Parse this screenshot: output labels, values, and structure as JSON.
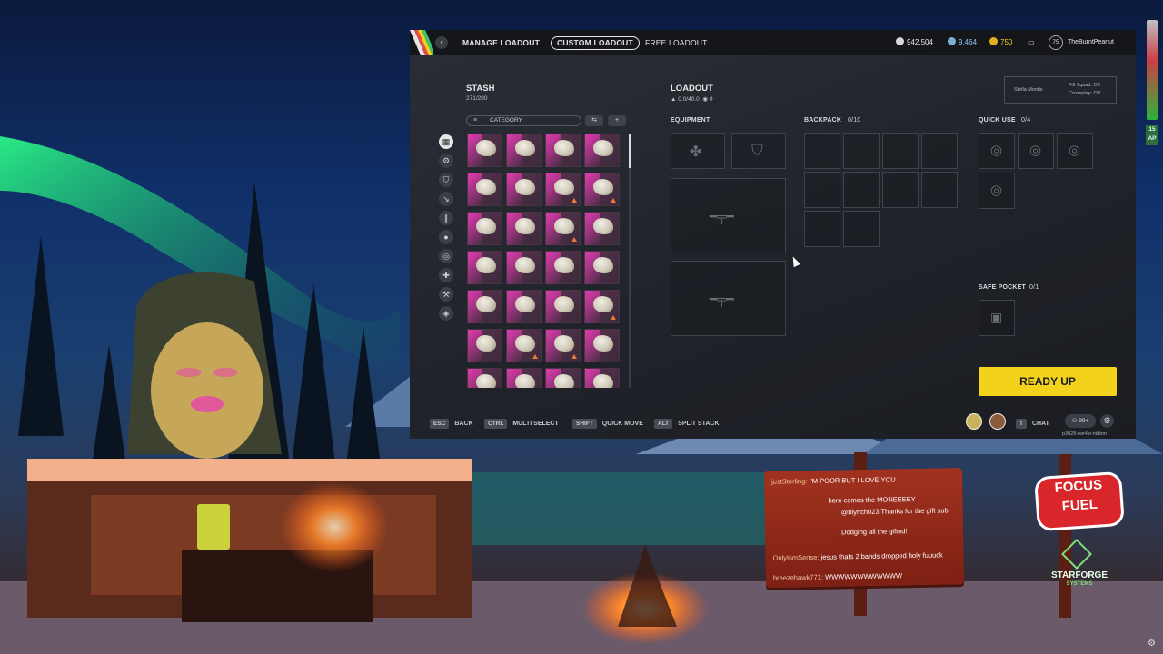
{
  "topbar": {
    "tabs": [
      {
        "label": "MANAGE LOADOUT",
        "active": false
      },
      {
        "label": "CUSTOM LOADOUT",
        "active": true
      },
      {
        "label": "FREE LOADOUT",
        "active": false
      }
    ],
    "currency1": "942,504",
    "currency2": "9,464",
    "currency3": "750",
    "level": "75",
    "username": "TheBurntPeanut"
  },
  "stash": {
    "title": "STASH",
    "count": "271/280",
    "category_label": "CATEGORY",
    "category_icons": [
      "grid-icon",
      "attachment-icon",
      "shield-icon",
      "knife-icon",
      "ammo-icon",
      "grenade-icon",
      "ring-icon",
      "medkit-icon",
      "wrench-icon",
      "cube-icon"
    ]
  },
  "loadout": {
    "title": "LOADOUT",
    "weight": "0.0/40.0",
    "value": "0",
    "server": "Stella Montis",
    "fill_squad": "Fill Squad: Off",
    "crossplay": "Crossplay: Off",
    "equipment_label": "EQUIPMENT",
    "backpack_label": "BACKPACK",
    "backpack_count": "0/10",
    "quick_use_label": "QUICK USE",
    "quick_use_count": "0/4",
    "safe_pocket_label": "SAFE POCKET",
    "safe_pocket_count": "0/1",
    "ready_label": "READY UP"
  },
  "hints": [
    {
      "key": "ESC",
      "label": "BACK"
    },
    {
      "key": "CTRL",
      "label": "MULTI SELECT"
    },
    {
      "key": "SHIFT",
      "label": "QUICK MOVE"
    },
    {
      "key": "ALT",
      "label": "SPLIT STACK"
    }
  ],
  "footer": {
    "chat_key": "T",
    "chat_label": "CHAT",
    "party_count": "99+",
    "session_code": "p3028-rwr4w-ntdbm"
  },
  "side_hud": {
    "ap": "15",
    "ap_label": "AP"
  },
  "stream_chat": [
    {
      "name": "justSterling:",
      "msg": "I'M POOR BUT I LOVE YOU"
    },
    {
      "name": "",
      "msg": "here comes the MONEEEEY"
    },
    {
      "name": "",
      "msg": "@blynch023 Thanks for the gift sub!"
    },
    {
      "name": "",
      "msg": "Dodging all the gifted!"
    },
    {
      "name": "",
      "msg": ""
    },
    {
      "name": "OnlyIsmSense:",
      "msg": "jesus thats 2 bands dropped holy fuuuck"
    },
    {
      "name": "breezehawk771:",
      "msg": "WWWWWWWWWWWW"
    }
  ],
  "focus_sign": {
    "line1": "FOCUS",
    "line2": "FUEL",
    "brand1": "STARFORGE",
    "brand2": "SYSTEMS"
  },
  "colors": {
    "accent": "#f3d21b",
    "stash_pink": "#e13ab0",
    "chat_sign": "#a2321f"
  }
}
